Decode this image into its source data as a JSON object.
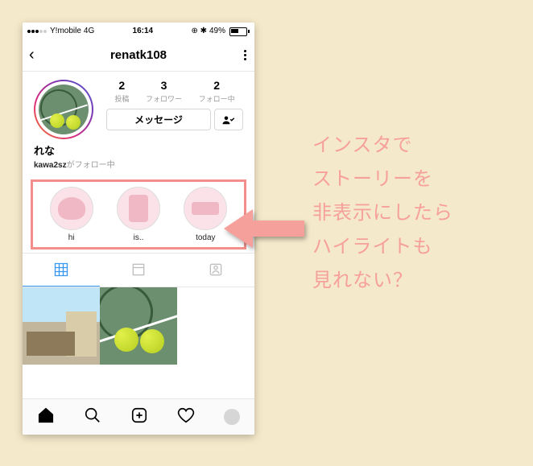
{
  "status": {
    "carrier": "Y!mobile",
    "network": "4G",
    "time": "16:14",
    "battery_pct": "49%",
    "icons_right": "⊕ ⤳ ⚡"
  },
  "nav": {
    "username": "renatk108"
  },
  "profile": {
    "stats": [
      {
        "value": "2",
        "label": "投稿"
      },
      {
        "value": "3",
        "label": "フォロワー"
      },
      {
        "value": "2",
        "label": "フォロー中"
      }
    ],
    "message_btn": "メッセージ",
    "display_name": "れな",
    "followed_by_user": "kawa2sz",
    "followed_by_suffix": "がフォロー中"
  },
  "highlights": [
    {
      "label": "hi"
    },
    {
      "label": "is.."
    },
    {
      "label": "today"
    }
  ],
  "caption": {
    "l1": "インスタで",
    "l2": "ストーリーを",
    "l3": "非表示にしたら",
    "l4": "ハイライトも",
    "l5": "見れない？"
  },
  "colors": {
    "highlight_box": "#f48e8a",
    "caption_text": "#f6a09c",
    "tab_active": "#3897f0"
  }
}
